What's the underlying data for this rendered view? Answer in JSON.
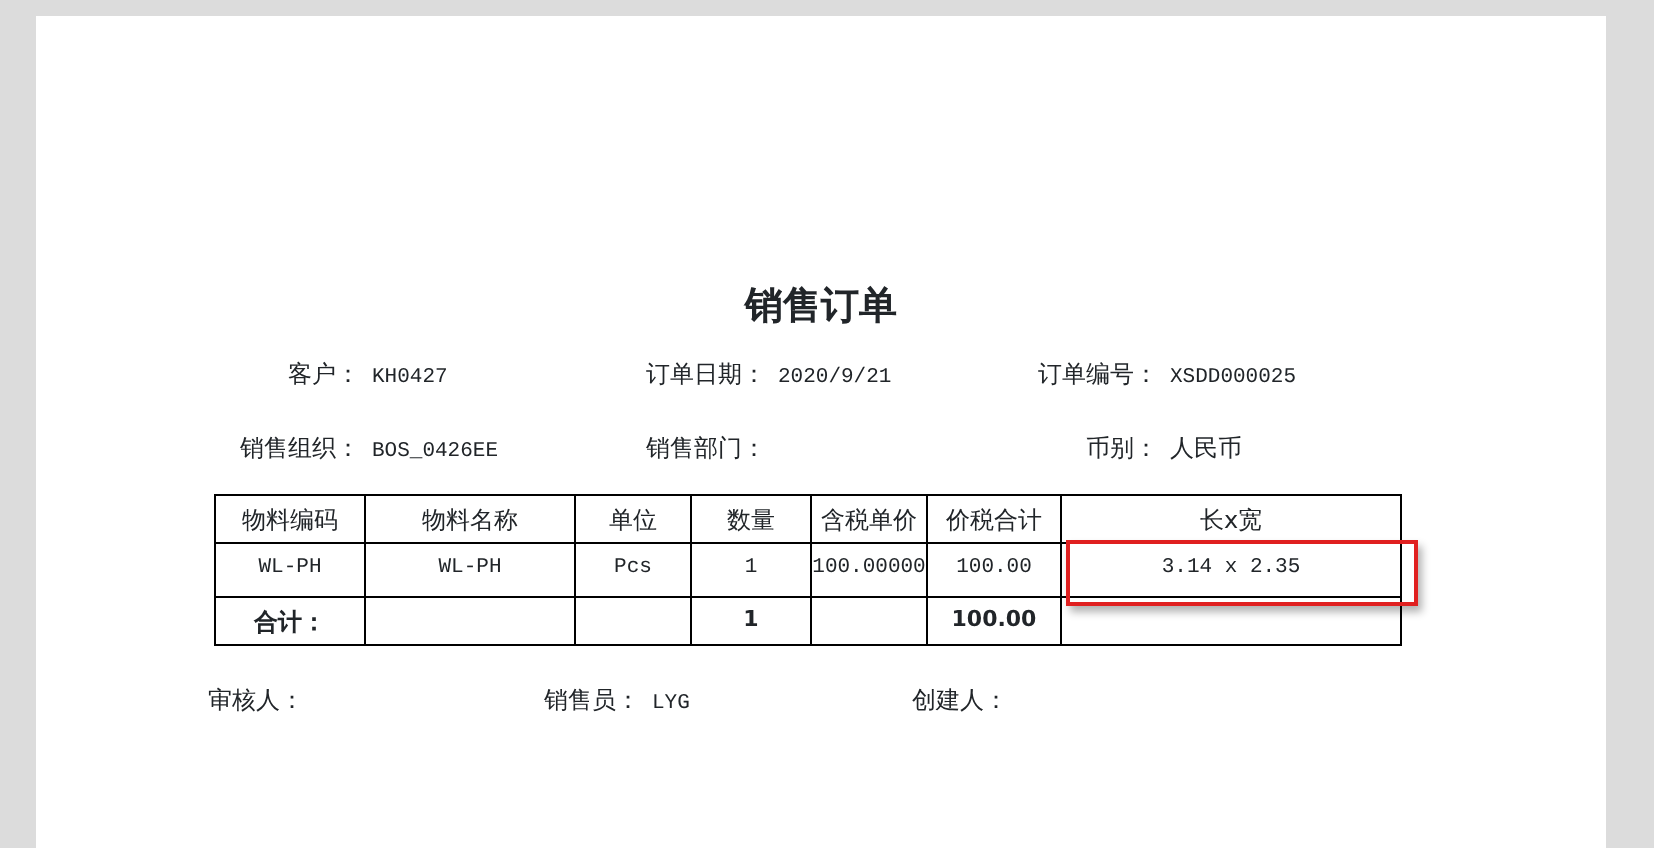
{
  "title": "销售订单",
  "fields": [
    {
      "label": "客户：",
      "value": "KH0427"
    },
    {
      "label": "订单日期：",
      "value": "2020/9/21"
    },
    {
      "label": "订单编号：",
      "value": "XSDD000025"
    },
    {
      "label": "销售组织：",
      "value": "BOS_0426EE"
    },
    {
      "label": "销售部门："
    },
    {
      "label": "币别：",
      "value": "人民币"
    }
  ],
  "table": {
    "columns": [
      "物料编码",
      "物料名称",
      "单位",
      "数量",
      "含税单价",
      "价税合计",
      "长x宽"
    ],
    "rows": [
      {
        "cells": [
          {
            "text": "WL-PH",
            "highlighted": false
          },
          {
            "text": "WL-PH",
            "highlighted": false
          },
          {
            "text": "Pcs",
            "highlighted": false
          },
          {
            "text": "1",
            "highlighted": false
          },
          {
            "text": "100.00000",
            "highlighted": false
          },
          {
            "text": "100.00",
            "highlighted": false
          },
          {
            "text": "3.14 x 2.35",
            "highlighted": true
          }
        ]
      }
    ],
    "total": {
      "label": "合计：",
      "quantity": "1",
      "amount": "100.00"
    }
  },
  "footer": [
    {
      "label": "审核人："
    },
    {
      "label": "销售员：",
      "value": "LYG"
    },
    {
      "label": "创建人："
    }
  ]
}
